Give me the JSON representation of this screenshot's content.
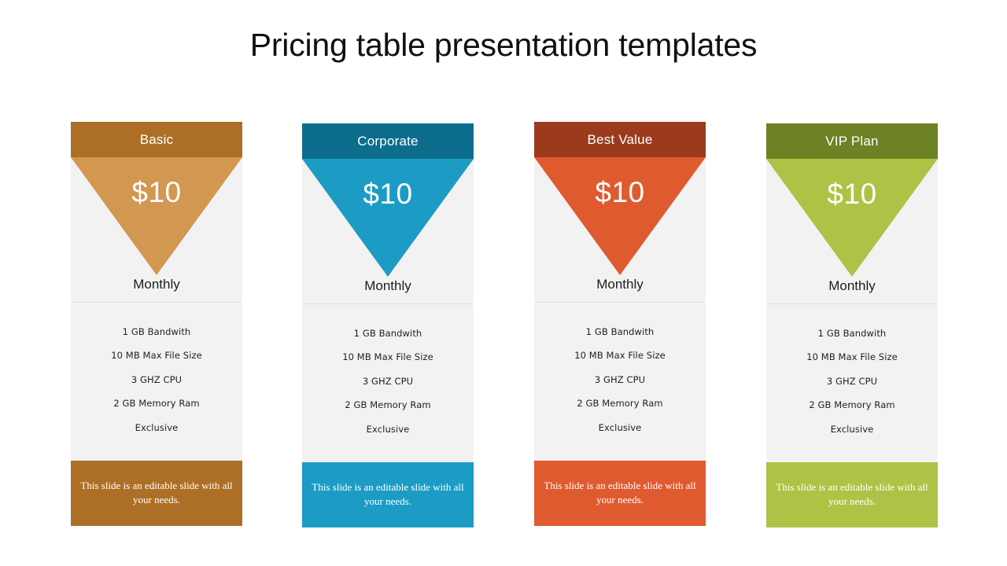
{
  "slide": {
    "title": "Pricing table presentation templates",
    "background": "#ffffff",
    "card_body_bg": "#f2f2f2",
    "divider_color": "#dcdcdc"
  },
  "cards": [
    {
      "plan_name": "Basic",
      "price": "$10",
      "period": "Monthly",
      "header_color": "#ad6f25",
      "accent_color": "#d29751",
      "footer_color": "#ad6f25",
      "features": [
        "1 GB Bandwith",
        "10 MB Max File Size",
        "3 GHZ CPU",
        "2 GB Memory Ram",
        "Exclusive"
      ],
      "footer_text": "This slide is an editable slide with all your needs."
    },
    {
      "plan_name": "Corporate",
      "price": "$10",
      "period": "Monthly",
      "header_color": "#0c6e8c",
      "accent_color": "#1c9cc4",
      "footer_color": "#1c9cc4",
      "features": [
        "1 GB Bandwith",
        "10 MB Max File Size",
        "3 GHZ CPU",
        "2 GB Memory Ram",
        "Exclusive"
      ],
      "footer_text": "This slide is an editable slide with all your needs."
    },
    {
      "plan_name": "Best Value",
      "price": "$10",
      "period": "Monthly",
      "header_color": "#9c3a1e",
      "accent_color": "#e05a30",
      "footer_color": "#e05a30",
      "features": [
        "1 GB Bandwith",
        "10 MB Max File Size",
        "3 GHZ CPU",
        "2 GB Memory Ram",
        "Exclusive"
      ],
      "footer_text": "This slide is an editable slide with all your needs."
    },
    {
      "plan_name": "VIP Plan",
      "price": "$10",
      "period": "Monthly",
      "header_color": "#6d8224",
      "accent_color": "#aec345",
      "footer_color": "#aec345",
      "features": [
        "1 GB Bandwith",
        "10 MB Max File Size",
        "3 GHZ CPU",
        "2 GB Memory Ram",
        "Exclusive"
      ],
      "footer_text": "This slide is an editable slide with all your needs."
    }
  ]
}
